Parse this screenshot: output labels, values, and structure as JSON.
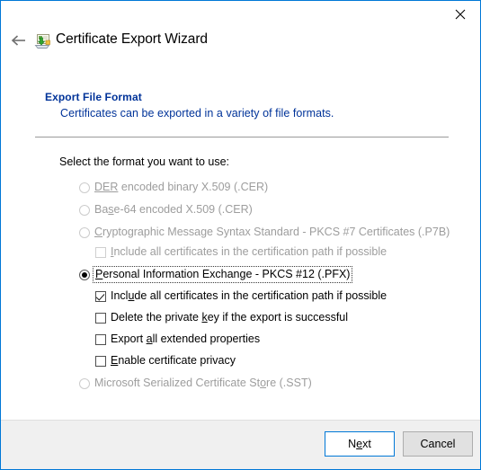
{
  "window": {
    "title": "Certificate Export Wizard",
    "title_icon": "certificate-export-icon",
    "close_icon": "close-icon",
    "back_icon": "back-arrow-icon",
    "border_color": "#0078d7"
  },
  "header": {
    "title": "Export File Format",
    "subtitle": "Certificates can be exported in a variety of file formats.",
    "color": "#003399"
  },
  "body": {
    "prompt": "Select the format you want to use:",
    "options": [
      {
        "id": "der",
        "type": "radio",
        "label_pre": "",
        "accesskey": "DER",
        "label_post": " encoded binary X.509 (.CER)",
        "checked": false,
        "disabled": true,
        "indent": 0
      },
      {
        "id": "base64",
        "type": "radio",
        "label_pre": "Ba",
        "accesskey": "s",
        "label_post": "e-64 encoded X.509 (.CER)",
        "checked": false,
        "disabled": true,
        "indent": 0
      },
      {
        "id": "pkcs7",
        "type": "radio",
        "label_pre": "",
        "accesskey": "C",
        "label_post": "ryptographic Message Syntax Standard - PKCS #7 Certificates (.P7B)",
        "checked": false,
        "disabled": true,
        "indent": 0
      },
      {
        "id": "p7b-include-all",
        "type": "checkbox",
        "label_pre": "",
        "accesskey": "I",
        "label_post": "nclude all certificates in the certification path if possible",
        "checked": false,
        "disabled": true,
        "indent": 1
      },
      {
        "id": "pfx",
        "type": "radio",
        "label_pre": "",
        "accesskey": "P",
        "label_post": "ersonal Information Exchange - PKCS #12 (.PFX)",
        "checked": true,
        "disabled": false,
        "focused": true,
        "indent": 0
      },
      {
        "id": "pfx-include-all",
        "type": "checkbox",
        "label_pre": "Incl",
        "accesskey": "u",
        "label_post": "de all certificates in the certification path if possible",
        "checked": true,
        "disabled": false,
        "indent": 1
      },
      {
        "id": "delete-private-key",
        "type": "checkbox",
        "label_pre": "Delete the private ",
        "accesskey": "k",
        "label_post": "ey if the export is successful",
        "checked": false,
        "disabled": false,
        "indent": 1
      },
      {
        "id": "export-extended",
        "type": "checkbox",
        "label_pre": "Export ",
        "accesskey": "a",
        "label_post": "ll extended properties",
        "checked": false,
        "disabled": false,
        "indent": 1
      },
      {
        "id": "enable-privacy",
        "type": "checkbox",
        "label_pre": "",
        "accesskey": "E",
        "label_post": "nable certificate privacy",
        "checked": false,
        "disabled": false,
        "indent": 1
      },
      {
        "id": "sst",
        "type": "radio",
        "label_pre": "Microsoft Serialized Certificate St",
        "accesskey": "o",
        "label_post": "re (.SST)",
        "checked": false,
        "disabled": true,
        "indent": 0
      }
    ]
  },
  "footer": {
    "next_pre": "N",
    "next_key": "e",
    "next_post": "xt",
    "next_label": "Next",
    "cancel_label": "Cancel"
  }
}
